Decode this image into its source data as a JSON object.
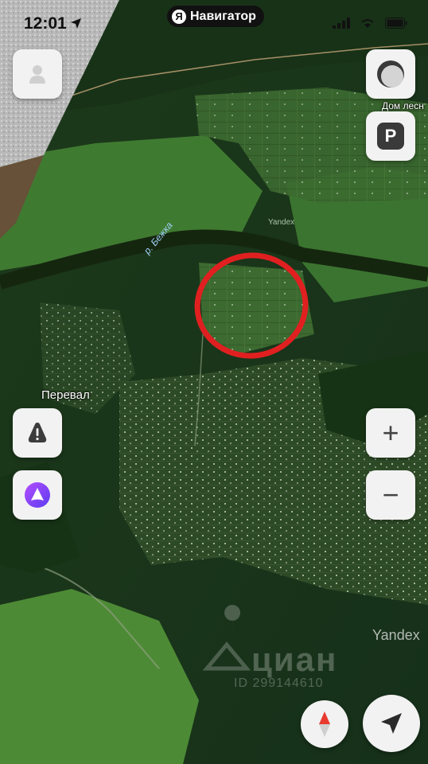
{
  "status_bar": {
    "time": "12:01"
  },
  "app": {
    "name": "Навигатор",
    "badge": "Я"
  },
  "map": {
    "labels": {
      "perevaL": "Перевал",
      "river": "р. Бежка",
      "dom": "Дом лесн",
      "yandex_small": "Yandex",
      "yandex_large": "Yandex"
    },
    "watermark": {
      "text": "циан",
      "id": "ID 299144610"
    },
    "highlight_color": "#e02020"
  },
  "controls": {
    "profile_icon": "person-icon",
    "layers_icon": "layers-icon",
    "parking_label": "P",
    "alert_icon": "warning-triangle-icon",
    "alice_icon": "alice-icon",
    "zoom_in": "+",
    "zoom_out": "−",
    "compass_icon": "compass-icon",
    "locate_icon": "locate-arrow-icon"
  },
  "colors": {
    "accent": "#8a3ffc",
    "button_bg": "#f2f2f2",
    "icon": "#444444"
  }
}
